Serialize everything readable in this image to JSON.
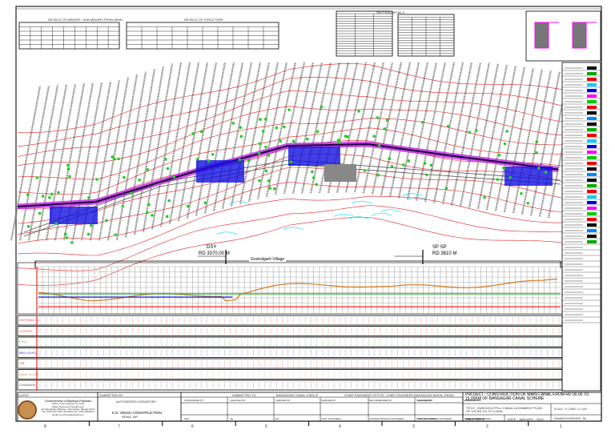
{
  "markers": [
    {
      "name": "DSY",
      "rd": "RD 3370.00 M"
    },
    {
      "name": "SP SP",
      "rd": "RD 3810 M"
    }
  ],
  "village": "Govindgarh Village",
  "tables": {
    "left_title": "DETAILS OF MINORS / SUB MINORS FROM MAIN",
    "mid_title": "DETAILS OF STRUCTURE",
    "right_title": "SECTION DETAILS"
  },
  "profile_rows": [
    "EXISTING GL",
    "CUT/FILL",
    "F.S.L.",
    "BED LEVEL",
    "TBL",
    "BANK LEVEL",
    "CHAINAGE"
  ],
  "profile_row_colors": [
    "#e33",
    "#e33",
    "#3a3",
    "#33c",
    "#e33",
    "#e09040",
    "#555"
  ],
  "title_block": {
    "client_label": "CLIENT",
    "client": [
      "Government of Madhya Pradesh",
      "Office of the Engineer-in-Chief",
      "Water Resources Department",
      "Jal Sansadhan Bhawan, Tulsi Nagar, Bhopal (M.P.)",
      "Tel: 0755-2577400, 2575433 Fax: 0755-2552434",
      "Email: eic.wrdmp@gmail.com"
    ],
    "submitted_by_label": "SUBMITTED BY",
    "authorized": "AUTHORIZED SIGNATORY",
    "contractor": "K.D. SINGH CONSTRUCTION",
    "contractor_city": "REWA, MP",
    "submitted_to_label": "SUBMITTED TO",
    "circle": "BANSAGAR CANAL CIRCLE",
    "chief": "CHIEF ENGINEER OFFICE, CHIEF ENGINEER BANSAGAR BASIN, REWA",
    "roles": [
      "FORWARDED BY",
      "CHECKED BY",
      "VERIFIED BY",
      "VERIFIED BY",
      "RECOMMENDED BY",
      "CHECKED BY",
      "CHECKED BY",
      "CHECKED BY",
      "APPROVED BY"
    ],
    "signers": [
      "SDO",
      "AE",
      "EE",
      "ASST. ENGINEER",
      "SUPERINTENDING ENGINEER",
      "ASST. ENGINEER",
      "EXECUTIVE ENGINEER",
      "SUPERINTENDING ENGINEER",
      "CHIEF ENGINEER"
    ],
    "project": "PROJECT : CONSTRUCTION OF MAIN CANAL FROM RD 00.00 TO 15.00KM OF BANSAGAR CANAL SCHEME",
    "title": "TITLE : INDEX/CUT/FILL CANAL ALIGNMENT PLAN OF L/S RD 3.0 TO 4.0KM",
    "scale": "SCALE : H 1:2500 / V 1:100",
    "dwg": "DWG. NO. 4",
    "date": "DATE : JANUARY - 2024",
    "drawn": "DRAWN BY/REVISED : NIL"
  },
  "sheet_cols": [
    "8",
    "7",
    "6",
    "5",
    "4",
    "3",
    "2",
    "1"
  ],
  "colors": {
    "canal": "#c030e0",
    "contour": "#e02020",
    "structure": "#1010e0",
    "tree": "#20d020",
    "water": "#20e0f0"
  }
}
